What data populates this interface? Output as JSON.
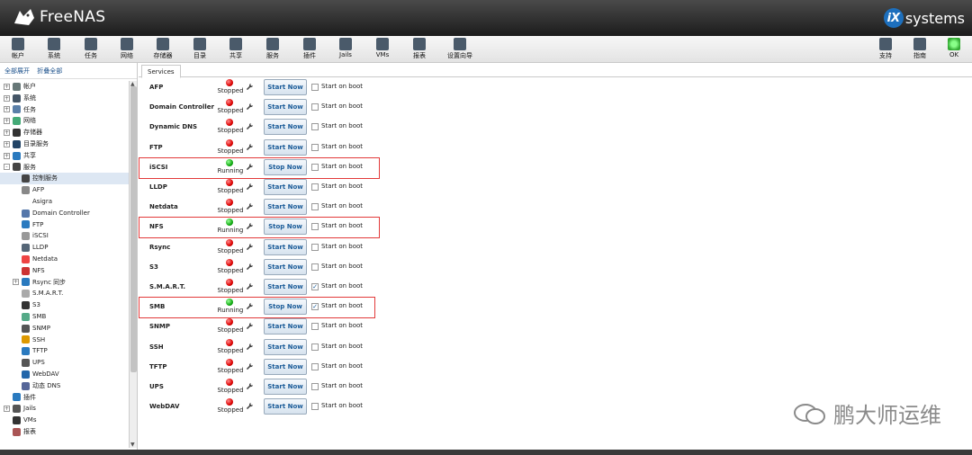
{
  "app": {
    "name": "FreeNAS",
    "vendor": "systems",
    "vendor_badge": "iX"
  },
  "toolbar": {
    "left": [
      {
        "label": "帐户",
        "icon": "users-icon"
      },
      {
        "label": "系统",
        "icon": "system-icon"
      },
      {
        "label": "任务",
        "icon": "tasks-icon"
      },
      {
        "label": "网络",
        "icon": "network-icon"
      },
      {
        "label": "存储器",
        "icon": "storage-icon"
      },
      {
        "label": "目录",
        "icon": "directory-icon"
      },
      {
        "label": "共享",
        "icon": "sharing-icon"
      },
      {
        "label": "服务",
        "icon": "services-icon"
      },
      {
        "label": "插件",
        "icon": "plugins-icon"
      },
      {
        "label": "Jails",
        "icon": "jails-icon"
      },
      {
        "label": "VMs",
        "icon": "vms-icon"
      },
      {
        "label": "报表",
        "icon": "reports-icon"
      },
      {
        "label": "设置向导",
        "icon": "wizard-icon"
      }
    ],
    "right": [
      {
        "label": "支持",
        "icon": "support-icon"
      },
      {
        "label": "指南",
        "icon": "guide-icon"
      },
      {
        "label": "OK",
        "icon": "alert-ok-icon"
      }
    ]
  },
  "tree": {
    "expand_all": "全部展开",
    "collapse_all": "折叠全部",
    "items": [
      {
        "label": "帐户",
        "level": 0,
        "exp": "+"
      },
      {
        "label": "系统",
        "level": 0,
        "exp": "+"
      },
      {
        "label": "任务",
        "level": 0,
        "exp": "+"
      },
      {
        "label": "网络",
        "level": 0,
        "exp": "+"
      },
      {
        "label": "存储器",
        "level": 0,
        "exp": "+"
      },
      {
        "label": "目录服务",
        "level": 0,
        "exp": "+"
      },
      {
        "label": "共享",
        "level": 0,
        "exp": "+"
      },
      {
        "label": "服务",
        "level": 0,
        "exp": "-"
      },
      {
        "label": "控制服务",
        "level": 1,
        "exp": "",
        "selected": true
      },
      {
        "label": "AFP",
        "level": 1,
        "exp": ""
      },
      {
        "label": "Asigra",
        "level": 1,
        "exp": ""
      },
      {
        "label": "Domain Controller",
        "level": 1,
        "exp": ""
      },
      {
        "label": "FTP",
        "level": 1,
        "exp": ""
      },
      {
        "label": "iSCSI",
        "level": 1,
        "exp": ""
      },
      {
        "label": "LLDP",
        "level": 1,
        "exp": ""
      },
      {
        "label": "Netdata",
        "level": 1,
        "exp": ""
      },
      {
        "label": "NFS",
        "level": 1,
        "exp": ""
      },
      {
        "label": "Rsync 同步",
        "level": 1,
        "exp": "+"
      },
      {
        "label": "S.M.A.R.T.",
        "level": 1,
        "exp": ""
      },
      {
        "label": "S3",
        "level": 1,
        "exp": ""
      },
      {
        "label": "SMB",
        "level": 1,
        "exp": ""
      },
      {
        "label": "SNMP",
        "level": 1,
        "exp": ""
      },
      {
        "label": "SSH",
        "level": 1,
        "exp": ""
      },
      {
        "label": "TFTP",
        "level": 1,
        "exp": ""
      },
      {
        "label": "UPS",
        "level": 1,
        "exp": ""
      },
      {
        "label": "WebDAV",
        "level": 1,
        "exp": ""
      },
      {
        "label": "动态 DNS",
        "level": 1,
        "exp": ""
      },
      {
        "label": "插件",
        "level": 0,
        "exp": ""
      },
      {
        "label": "Jails",
        "level": 0,
        "exp": "+"
      },
      {
        "label": "VMs",
        "level": 0,
        "exp": ""
      },
      {
        "label": "报表",
        "level": 0,
        "exp": ""
      }
    ]
  },
  "main": {
    "tab": "Services",
    "start_on_boot_label": "Start on boot",
    "services": [
      {
        "name": "AFP",
        "status": "Stopped",
        "button": "Start Now",
        "boot": false,
        "highlight": false
      },
      {
        "name": "Domain Controller",
        "status": "Stopped",
        "button": "Start Now",
        "boot": false,
        "highlight": false
      },
      {
        "name": "Dynamic DNS",
        "status": "Stopped",
        "button": "Start Now",
        "boot": false,
        "highlight": false
      },
      {
        "name": "FTP",
        "status": "Stopped",
        "button": "Start Now",
        "boot": false,
        "highlight": false
      },
      {
        "name": "iSCSI",
        "status": "Running",
        "button": "Stop Now",
        "boot": false,
        "highlight": true
      },
      {
        "name": "LLDP",
        "status": "Stopped",
        "button": "Start Now",
        "boot": false,
        "highlight": false
      },
      {
        "name": "Netdata",
        "status": "Stopped",
        "button": "Start Now",
        "boot": false,
        "highlight": false
      },
      {
        "name": "NFS",
        "status": "Running",
        "button": "Stop Now",
        "boot": false,
        "highlight": true
      },
      {
        "name": "Rsync",
        "status": "Stopped",
        "button": "Start Now",
        "boot": false,
        "highlight": false
      },
      {
        "name": "S3",
        "status": "Stopped",
        "button": "Start Now",
        "boot": false,
        "highlight": false
      },
      {
        "name": "S.M.A.R.T.",
        "status": "Stopped",
        "button": "Start Now",
        "boot": true,
        "highlight": false
      },
      {
        "name": "SMB",
        "status": "Running",
        "button": "Stop Now",
        "boot": true,
        "highlight": true
      },
      {
        "name": "SNMP",
        "status": "Stopped",
        "button": "Start Now",
        "boot": false,
        "highlight": false
      },
      {
        "name": "SSH",
        "status": "Stopped",
        "button": "Start Now",
        "boot": false,
        "highlight": false
      },
      {
        "name": "TFTP",
        "status": "Stopped",
        "button": "Start Now",
        "boot": false,
        "highlight": false
      },
      {
        "name": "UPS",
        "status": "Stopped",
        "button": "Start Now",
        "boot": false,
        "highlight": false
      },
      {
        "name": "WebDAV",
        "status": "Stopped",
        "button": "Start Now",
        "boot": false,
        "highlight": false
      }
    ]
  },
  "watermark": {
    "text": "鹏大师运维"
  },
  "colors": {
    "running": "#1a1",
    "stopped": "#d00",
    "highlight": "#e23a3a",
    "link": "#1a4f8a"
  }
}
